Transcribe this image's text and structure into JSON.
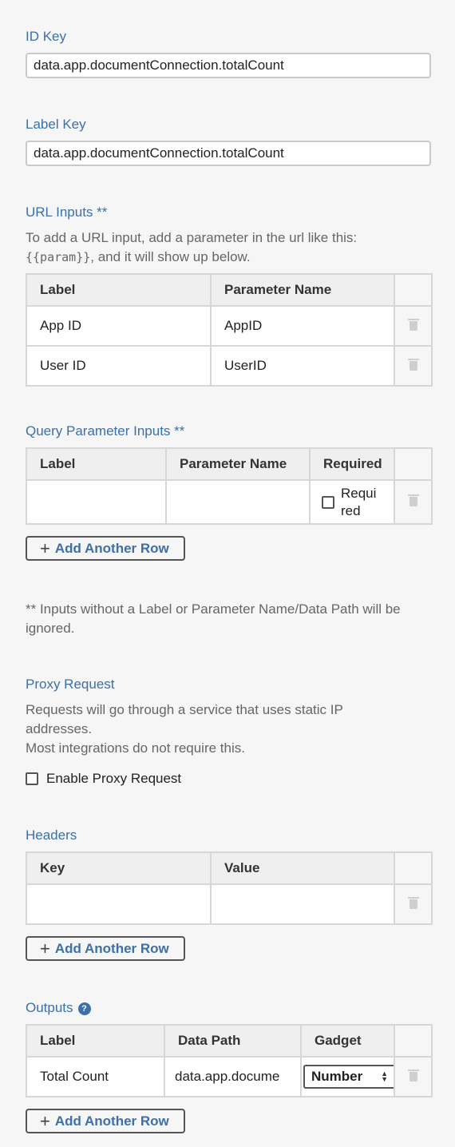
{
  "id_key": {
    "label": "ID Key",
    "value": "data.app.documentConnection.totalCount"
  },
  "label_key": {
    "label": "Label Key",
    "value": "data.app.documentConnection.totalCount"
  },
  "url_inputs": {
    "title": "URL Inputs **",
    "help_prefix": "To add a URL input, add a parameter in the url like this:",
    "help_code": "{{param}}",
    "help_suffix": ", and it will show up below.",
    "columns": [
      "Label",
      "Parameter Name"
    ],
    "rows": [
      {
        "label": "App ID",
        "param": "AppID"
      },
      {
        "label": "User ID",
        "param": "UserID"
      }
    ]
  },
  "query_inputs": {
    "title": "Query Parameter Inputs **",
    "columns": [
      "Label",
      "Parameter Name",
      "Required"
    ],
    "row": {
      "required_label_1": "Requi",
      "required_label_2": "red"
    },
    "add_label": "Add Another Row"
  },
  "inputs_note": "** Inputs without a Label or Parameter Name/Data Path will be ignored.",
  "proxy": {
    "title": "Proxy Request",
    "help_1": "Requests will go through a service that uses static IP addresses.",
    "help_2": "Most integrations do not require this.",
    "checkbox_label": "Enable Proxy Request"
  },
  "headers": {
    "title": "Headers",
    "columns": [
      "Key",
      "Value"
    ],
    "add_label": "Add Another Row"
  },
  "outputs": {
    "title": "Outputs",
    "help_icon": "?",
    "columns": [
      "Label",
      "Data Path",
      "Gadget"
    ],
    "row": {
      "label": "Total Count",
      "data_path": "data.app.docume",
      "gadget": "Number"
    },
    "add_label": "Add Another Row"
  }
}
